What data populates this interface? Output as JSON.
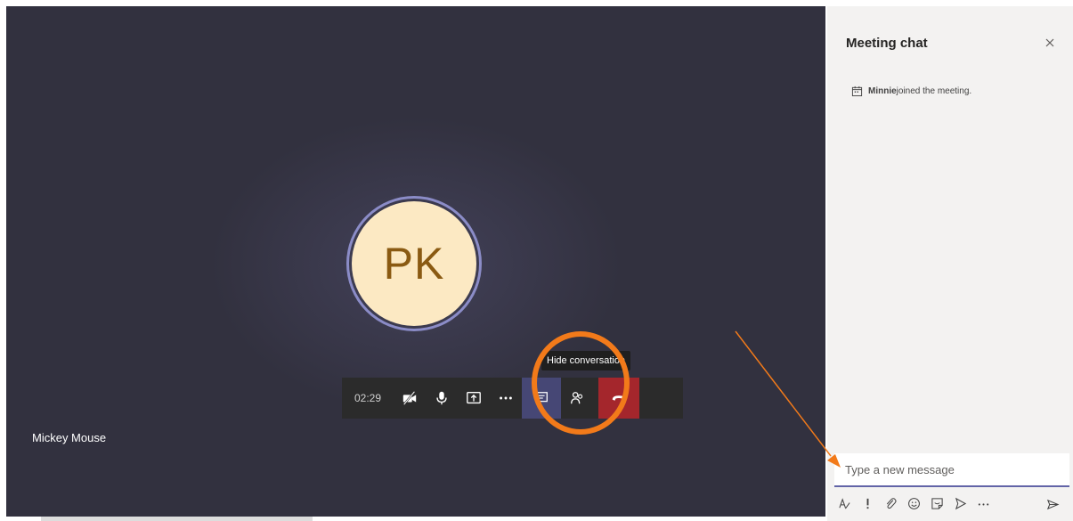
{
  "call": {
    "avatar_initials": "PK",
    "participant_name": "Mickey Mouse",
    "timer": "02:29",
    "tooltip": "Hide conversation",
    "colors": {
      "stage_bg": "#32313f",
      "avatar_bg": "#fce9c3",
      "avatar_ring": "#8b8cc7",
      "hangup": "#a4262c",
      "active_button": "#464775",
      "annotation": "#f27a1a"
    },
    "toolbar_icons": [
      "camera-off-icon",
      "microphone-icon",
      "share-screen-icon",
      "more-options-icon",
      "chat-icon",
      "participants-icon",
      "hang-up-icon"
    ]
  },
  "chat": {
    "title": "Meeting chat",
    "event": {
      "name": "Minnie",
      "text": " joined the meeting."
    },
    "compose_placeholder": "Type a new message",
    "compose_icons": [
      "format-icon",
      "important-icon",
      "attach-icon",
      "emoji-icon",
      "sticker-icon",
      "praise-icon",
      "more-icon",
      "send-icon"
    ]
  }
}
